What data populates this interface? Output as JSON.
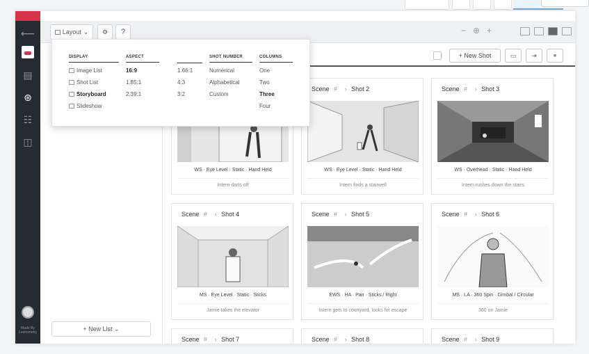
{
  "toolbar": {
    "layout_label": "Layout",
    "help_label": "?",
    "zoom_out": "−",
    "zoom_in": "+"
  },
  "layout_menu": {
    "columns": [
      {
        "header": "DISPLAY",
        "options": [
          "Image List",
          "Shot List",
          "Storyboard",
          "Slideshow"
        ],
        "selected": "Storyboard"
      },
      {
        "header": "ASPECT",
        "options": [
          "16:9",
          "1.85:1",
          "2.39:1"
        ],
        "selected": "16:9"
      },
      {
        "header": "",
        "options": [
          "1.66:1",
          "4:3",
          "3:2"
        ],
        "selected": ""
      },
      {
        "header": "SHOT NUMBER",
        "options": [
          "Numerical",
          "Alphabetical",
          "Custom"
        ],
        "selected": ""
      },
      {
        "header": "COLUMNS",
        "options": [
          "One",
          "Two",
          "Three",
          "Four"
        ],
        "selected": "Three"
      }
    ]
  },
  "content_header": {
    "new_shot_label": "+ New Shot"
  },
  "left_panel": {
    "new_list_label": "+ New List ⌄"
  },
  "rail": {
    "credit": "Made By Leanometry"
  },
  "shots": [
    {
      "scene": "Scene",
      "hash": "#",
      "shot": "Shot 2",
      "meta": "WS · Eye Level · Static · Hand Held",
      "desc": "Intern finds a stairwell"
    },
    {
      "scene": "Scene",
      "hash": "#",
      "shot": "Shot 3",
      "meta": "WS · Overhead · Static · Hand Held",
      "desc": "Intern rushes down the stairs"
    },
    {
      "scene": "Scene",
      "hash": "#",
      "shot": "Shot 4",
      "meta": "MS · Eye Level · Static · Sticks",
      "desc": "Jamie takes the elevator"
    },
    {
      "scene": "Scene",
      "hash": "#",
      "shot": "Shot 5",
      "meta": "EWS · HA · Pan · Sticks / Right",
      "desc": "Intern gets to courtyard, looks for escape"
    },
    {
      "scene": "Scene",
      "hash": "#",
      "shot": "Shot 6",
      "meta": "MS · LA · 360 Spin · Gimbal / Circular",
      "desc": "360 on Jamie"
    },
    {
      "scene": "Scene",
      "hash": "#",
      "shot": "Shot 7"
    },
    {
      "scene": "Scene",
      "hash": "#",
      "shot": "Shot 8"
    },
    {
      "scene": "Scene",
      "hash": "#",
      "shot": "Shot 9"
    }
  ],
  "shot1": {
    "meta": "WS · Eye Level · Static · Hand Held",
    "desc": "Intern darts off"
  },
  "colors": {
    "rail": "#262a33",
    "brand": "#d9334a",
    "accent": "#6fa8dc"
  }
}
